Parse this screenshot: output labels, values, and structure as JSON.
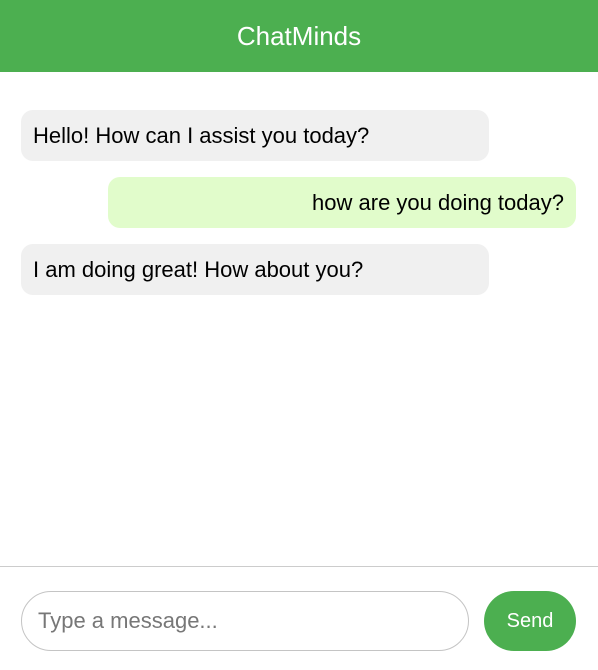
{
  "app": {
    "title": "ChatMinds"
  },
  "colors": {
    "accent": "#4caf50",
    "bot_bubble": "#f0f0f0",
    "user_bubble": "#e1fccb"
  },
  "messages": [
    {
      "sender": "bot",
      "text": "Hello! How can I assist you today?"
    },
    {
      "sender": "user",
      "text": "how are you doing today?"
    },
    {
      "sender": "bot",
      "text": "I am doing great! How about you?"
    }
  ],
  "composer": {
    "value": "",
    "placeholder": "Type a message...",
    "send_label": "Send"
  }
}
